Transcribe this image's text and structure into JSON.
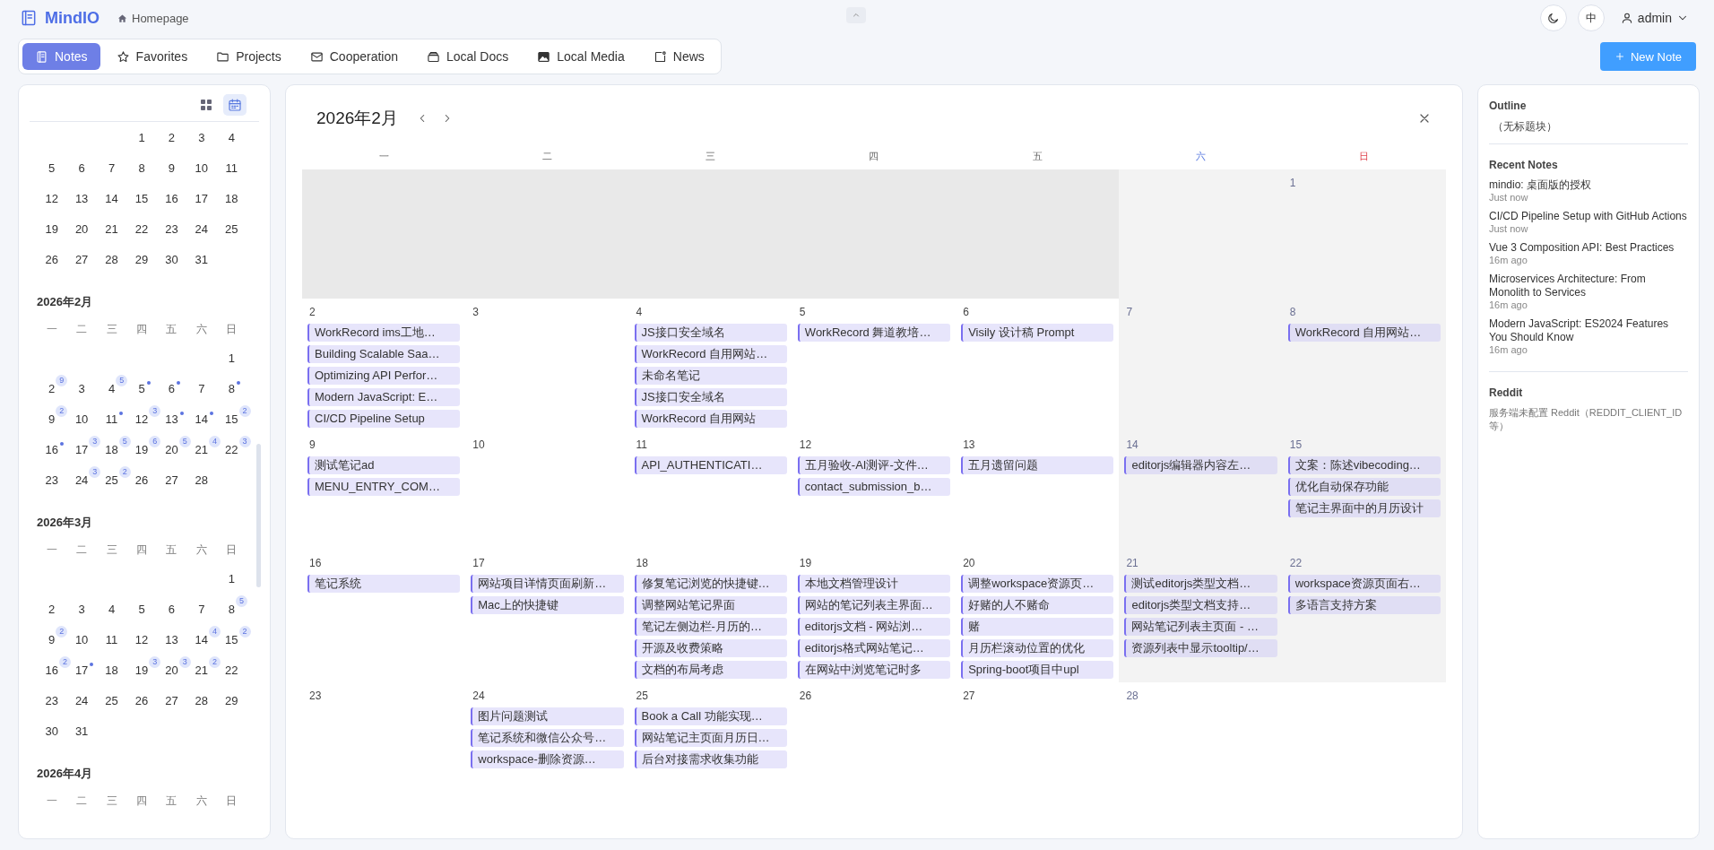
{
  "header": {
    "logo": "MindIO",
    "breadcrumb": "Homepage",
    "language": "中",
    "user": "admin"
  },
  "tabs": [
    {
      "label": "Notes",
      "selected": true
    },
    {
      "label": "Favorites",
      "selected": false
    },
    {
      "label": "Projects",
      "selected": false
    },
    {
      "label": "Cooperation",
      "selected": false
    },
    {
      "label": "Local Docs",
      "selected": false
    },
    {
      "label": "Local Media",
      "selected": false
    },
    {
      "label": "News",
      "selected": false
    }
  ],
  "new_note_button": "New Note",
  "sidebar": {
    "views": [
      {
        "selected": false
      },
      {
        "selected": true
      }
    ],
    "months": [
      {
        "weeks": [
          [
            {
              "kind": "blank"
            },
            {
              "kind": "blank"
            },
            {
              "kind": "blank"
            },
            "1",
            "2",
            "3",
            "4"
          ],
          [
            "5",
            "6",
            "7",
            "8",
            "9",
            "10",
            "11"
          ],
          [
            "12",
            "13",
            "14",
            "15",
            "16",
            "17",
            "18"
          ],
          [
            "19",
            "20",
            "21",
            "22",
            "23",
            "24",
            "25"
          ],
          [
            "26",
            "27",
            "28",
            "29",
            "30",
            "31"
          ]
        ]
      },
      {
        "title": "2026年2月",
        "weekdays": [
          "一",
          "二",
          "三",
          "四",
          "五",
          "六",
          "日"
        ],
        "weeks": [
          [
            {
              "kind": "blank"
            },
            {
              "kind": "blank"
            },
            {
              "kind": "blank"
            },
            {
              "kind": "blank"
            },
            {
              "kind": "blank"
            },
            {
              "kind": "blank"
            },
            "1"
          ],
          [
            {
              "day": "2",
              "kind": "count",
              "count": "9"
            },
            "3",
            {
              "day": "4",
              "kind": "count",
              "count": "5"
            },
            {
              "day": "5",
              "kind": "dot"
            },
            {
              "day": "6",
              "kind": "dot"
            },
            "7",
            {
              "day": "8",
              "kind": "dot"
            }
          ],
          [
            {
              "day": "9",
              "kind": "count",
              "count": "2"
            },
            "10",
            {
              "day": "11",
              "kind": "dot"
            },
            {
              "day": "12",
              "kind": "count",
              "count": "3"
            },
            {
              "day": "13",
              "kind": "dot"
            },
            {
              "day": "14",
              "kind": "dot"
            },
            {
              "day": "15",
              "kind": "count",
              "count": "2"
            }
          ],
          [
            {
              "day": "16",
              "kind": "dot"
            },
            {
              "day": "17",
              "kind": "count",
              "count": "3"
            },
            {
              "day": "18",
              "kind": "count",
              "count": "5"
            },
            {
              "day": "19",
              "kind": "count",
              "count": "6"
            },
            {
              "day": "20",
              "kind": "count",
              "count": "5"
            },
            {
              "day": "21",
              "kind": "count",
              "count": "4"
            },
            {
              "day": "22",
              "kind": "count",
              "count": "3"
            }
          ],
          [
            "23",
            {
              "day": "24",
              "kind": "count",
              "count": "3"
            },
            {
              "day": "25",
              "kind": "count",
              "count": "2"
            },
            "26",
            "27",
            "28"
          ]
        ]
      },
      {
        "title": "2026年3月",
        "weekdays": [
          "一",
          "二",
          "三",
          "四",
          "五",
          "六",
          "日"
        ],
        "weeks": [
          [
            {
              "kind": "blank"
            },
            {
              "kind": "blank"
            },
            {
              "kind": "blank"
            },
            {
              "kind": "blank"
            },
            {
              "kind": "blank"
            },
            {
              "kind": "blank"
            },
            "1"
          ],
          [
            "2",
            "3",
            "4",
            "5",
            "6",
            "7",
            {
              "day": "8",
              "kind": "count",
              "count": "5"
            }
          ],
          [
            {
              "day": "9",
              "kind": "count",
              "count": "2"
            },
            "10",
            "11",
            "12",
            "13",
            {
              "day": "14",
              "kind": "count",
              "count": "4"
            },
            {
              "day": "15",
              "kind": "count",
              "count": "2"
            }
          ],
          [
            {
              "day": "16",
              "kind": "count",
              "count": "2"
            },
            {
              "day": "17",
              "kind": "dot"
            },
            "18",
            {
              "day": "19",
              "kind": "count",
              "count": "3"
            },
            {
              "day": "20",
              "kind": "count",
              "count": "3"
            },
            {
              "day": "21",
              "kind": "count",
              "count": "2"
            },
            "22"
          ],
          [
            "23",
            "24",
            "25",
            "26",
            "27",
            "28",
            "29"
          ],
          [
            "30",
            "31"
          ]
        ]
      },
      {
        "title": "2026年4月",
        "weekdays": [
          "一",
          "二",
          "三",
          "四",
          "五",
          "六",
          "日"
        ]
      }
    ]
  },
  "calendar": {
    "title": "2026年2月",
    "weekdays": [
      "一",
      "二",
      "三",
      "四",
      "五",
      "六",
      "日"
    ],
    "weeks": [
      [
        {
          "kind": "outside"
        },
        {
          "kind": "outside"
        },
        {
          "kind": "outside"
        },
        {
          "kind": "outside"
        },
        {
          "kind": "outside"
        },
        {
          "kind": "weekend"
        },
        {
          "kind": "weekend",
          "day": "1"
        }
      ],
      [
        {
          "kind": "day",
          "day": "2",
          "notes": [
            "WorkRecord ims工地…",
            "Building Scalable Saa…",
            "Optimizing API Perfor…",
            "Modern JavaScript: E…",
            "CI/CD Pipeline Setup"
          ]
        },
        {
          "kind": "day",
          "day": "3"
        },
        {
          "kind": "day",
          "day": "4",
          "notes": [
            "JS接口安全域名",
            "WorkRecord 自用网站…",
            "未命名笔记",
            "JS接口安全域名",
            "WorkRecord 自用网站"
          ]
        },
        {
          "kind": "day",
          "day": "5",
          "notes": [
            "WorkRecord 舞道教培…"
          ]
        },
        {
          "kind": "day",
          "day": "6",
          "notes": [
            "Visily 设计稿 Prompt"
          ]
        },
        {
          "kind": "weekend",
          "day": "7"
        },
        {
          "kind": "weekend",
          "day": "8",
          "notes": [
            "WorkRecord 自用网站…"
          ]
        }
      ],
      [
        {
          "kind": "day",
          "day": "9",
          "notes": [
            "测试笔记ad",
            "MENU_ENTRY_COM…"
          ]
        },
        {
          "kind": "day",
          "day": "10"
        },
        {
          "kind": "day",
          "day": "11",
          "notes": [
            "API_AUTHENTICATI…"
          ]
        },
        {
          "kind": "day",
          "day": "12",
          "notes": [
            "五月验收-AI测评-文件…",
            "contact_submission_b…"
          ]
        },
        {
          "kind": "day",
          "day": "13",
          "notes": [
            "五月遗留问题"
          ]
        },
        {
          "kind": "weekend",
          "day": "14",
          "notes": [
            "editorjs编辑器内容左…"
          ]
        },
        {
          "kind": "weekend",
          "day": "15",
          "notes": [
            "文案：陈述vibecoding…",
            "优化自动保存功能",
            "笔记主界面中的月历设计"
          ]
        }
      ],
      [
        {
          "kind": "day",
          "day": "16",
          "notes": [
            "笔记系统"
          ]
        },
        {
          "kind": "day",
          "day": "17",
          "notes": [
            "网站项目详情页面刷新…",
            "Mac上的快捷键"
          ]
        },
        {
          "kind": "day",
          "day": "18",
          "notes": [
            "修复笔记浏览的快捷键…",
            "调整网站笔记界面",
            "笔记左侧边栏-月历的…",
            "开源及收费策略",
            "文档的布局考虑"
          ]
        },
        {
          "kind": "day",
          "day": "19",
          "notes": [
            "本地文档管理设计",
            "网站的笔记列表主界面…",
            "editorjs文档 - 网站浏…",
            "editorjs格式网站笔记…",
            "在网站中浏览笔记时多"
          ]
        },
        {
          "kind": "day",
          "day": "20",
          "notes": [
            "调整workspace资源页…",
            "好赌的人不赌命",
            "赌",
            "月历栏滚动位置的优化",
            "Spring-boot项目中upl"
          ]
        },
        {
          "kind": "weekend",
          "day": "21",
          "notes": [
            "测试editorjs类型文档…",
            "editorjs类型文档支持…",
            "网站笔记列表主页面 - …",
            "资源列表中显示tooltip/…"
          ]
        },
        {
          "kind": "weekend",
          "day": "22",
          "notes": [
            "workspace资源页面右…",
            "多语言支持方案"
          ]
        }
      ],
      [
        {
          "kind": "day",
          "day": "23"
        },
        {
          "kind": "day",
          "day": "24",
          "notes": [
            "图片问题测试",
            "笔记系统和微信公众号…",
            "workspace-删除资源…"
          ]
        },
        {
          "kind": "day",
          "day": "25",
          "notes": [
            "Book a Call 功能实现…",
            "网站笔记主页面月历日…",
            "后台对接需求收集功能"
          ]
        },
        {
          "kind": "day",
          "day": "26"
        },
        {
          "kind": "day",
          "day": "27"
        },
        {
          "kind": "day",
          "day": "28"
        }
      ]
    ]
  },
  "right_panel": {
    "outline_title": "Outline",
    "outline_items": [
      "（无标题块）"
    ],
    "recent_title": "Recent Notes",
    "recent_notes": [
      {
        "title": "mindio: 桌面版的授权",
        "time": "Just now"
      },
      {
        "title": "CI/CD Pipeline Setup with GitHub Actions",
        "time": "Just now"
      },
      {
        "title": "Vue 3 Composition API: Best Practices",
        "time": "16m ago"
      },
      {
        "title": "Microservices Architecture: From Monolith to Services",
        "time": "16m ago"
      },
      {
        "title": "Modern JavaScript: ES2024 Features You Should Know",
        "time": "16m ago"
      }
    ],
    "reddit_title": "Reddit",
    "reddit_message": "服务端未配置 Reddit（REDDIT_CLIENT_ID 等）"
  }
}
